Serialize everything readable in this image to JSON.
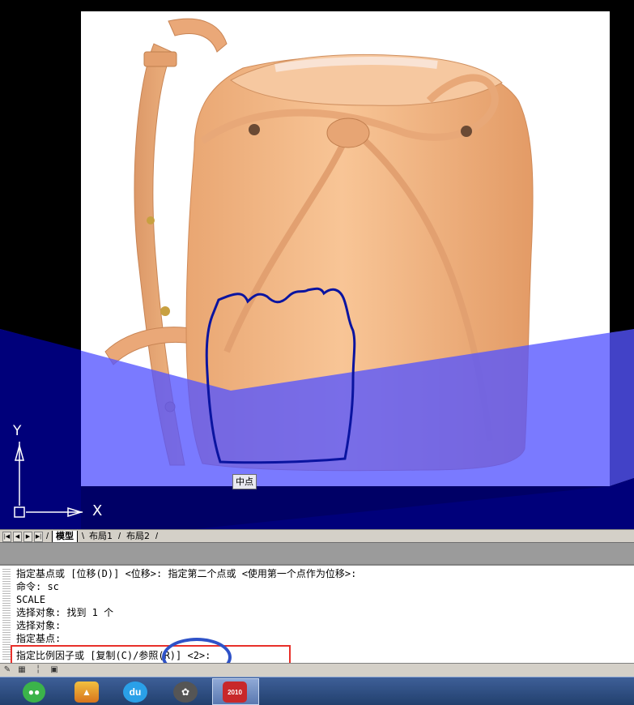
{
  "viewport": {
    "snap_tooltip": "中点",
    "ucs": {
      "x_label": "X",
      "y_label": "Y"
    }
  },
  "layout_tabs": {
    "nav_icons": [
      "first-tab-icon",
      "prev-tab-icon",
      "next-tab-icon",
      "last-tab-icon"
    ],
    "tabs": [
      {
        "label": "模型",
        "active": true
      },
      {
        "label": "布局1",
        "active": false
      },
      {
        "label": "布局2",
        "active": false
      }
    ]
  },
  "command_line": {
    "history": [
      "指定基点或 [位移(D)] <位移>:  指定第二个点或 <使用第一个点作为位移>:",
      "命令: sc",
      "SCALE",
      "选择对象: 找到 1 个",
      "选择对象:",
      "指定基点:"
    ],
    "prompt": "指定比例因子或 [复制(C)/参照(R)] <2>:"
  },
  "annotations": {
    "red_box_color": "#e8302a",
    "blue_oval_color": "#2e52c8"
  },
  "taskbar": {
    "apps": [
      "wechat-icon",
      "app-icon",
      "baidu-icon",
      "media-player-icon",
      "autocad-icon"
    ],
    "autocad_badge": "2010"
  },
  "colors": {
    "viewport_bg": "#000000",
    "selection_fill": "#5a5aff",
    "polyline": "#0a14a0",
    "bag_leather": "#f0b07e"
  }
}
